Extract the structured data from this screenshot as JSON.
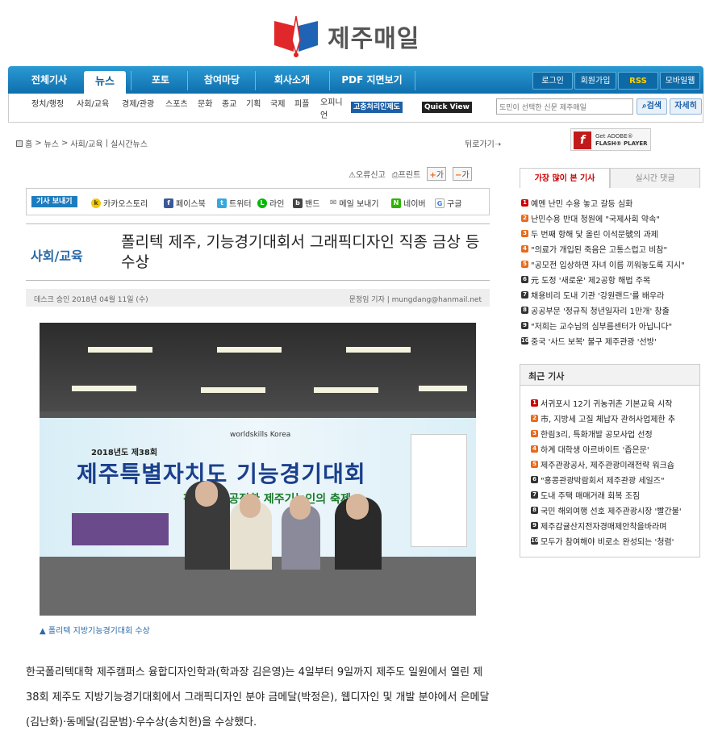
{
  "logo": {
    "text": "제주매일"
  },
  "nav": {
    "items": [
      "전체기사",
      "뉴스",
      "포토",
      "참여마당",
      "회사소개",
      "PDF 지면보기"
    ],
    "right": [
      "로그인",
      "회원가입",
      "RSS",
      "모바일웹"
    ]
  },
  "subnav": {
    "items": [
      "정치/행정",
      "사회/교육",
      "경제/관광",
      "스포츠",
      "문화",
      "종교",
      "기획",
      "국제",
      "피플",
      "오피니언"
    ],
    "btn_grievance": "고충처리인제도",
    "btn_quickview": "Quick View",
    "search_placeholder": "도민이 선택한 신문 제주매일",
    "search_btn": "검색",
    "detail_btn": "자세히"
  },
  "breadcrumb": {
    "home": "홈",
    "sep": ">",
    "l1": "뉴스",
    "l2": "사회/교육",
    "divider": "|",
    "l3": "실시간뉴스"
  },
  "back": "뒤로가기",
  "flash": {
    "line1": "Get ADOBE®",
    "line2": "FLASH® PLAYER"
  },
  "tools": {
    "report": "오류신고",
    "print": "프린트",
    "plus": "가",
    "minus": "가"
  },
  "share": {
    "label": "기사 보내기",
    "items": [
      "카카오스토리",
      "페이스북",
      "트위터",
      "라인",
      "밴드",
      "메일 보내기",
      "네이버",
      "구글"
    ]
  },
  "article": {
    "category": "사회/교육",
    "title": "폴리텍 제주, 기능경기대회서 그래픽디자인 직종 금상 등 수상",
    "meta_left": "데스크 승인 2018년 04월 11일 (수)",
    "meta_right": "문정임 기자 | mungdang@hanmail.net",
    "caption": "▲ 폴리텍 지방기능경기대회 수상",
    "body": "한국폴리텍대학 제주캠퍼스 융합디자인학과(학과장 김은영)는 4일부터 9일까지 제주도 일원에서 열린 제38회 제주도 지방기능경기대회에서 그래픽디자인 분야 금메달(박정은), 웹디자인 및 개발 분야에서 은메달(김난화)·동메달(김문범)·우수상(송치헌)을 수상했다."
  },
  "photo": {
    "banner_small": "2018년도 제38회",
    "banner_big": "제주특별자치도 기능경기대회",
    "banner_slogan": "청렴하고 공정한 제주기능인의 축제",
    "worldskills": "worldskills Korea"
  },
  "popular": {
    "tab_active": "가장 많이 본 기사",
    "tab_other": "실시간 댓글",
    "items": [
      "예멘 난민 수용 놓고 갈등 심화",
      "난민수용 반대 청원에 \"국제사회 약속\"",
      "두 번째 항해 닻 올린 이석문號의 과제",
      "\"의료가 개입된 죽음은 고통스럽고 비참\"",
      "\"공모전 입상하면 자녀 이름 끼워놓도록 지시\"",
      "元 도정 '새로운' 제2공항 해법 주목",
      "채용비리 도내 기관 '강원랜드'를 배우라",
      "공공부문 '정규직 청년일자리 1만개' 창출",
      "\"저희는 교수님의 심부름센터가 아닙니다\"",
      "중국 '사드 보복' 불구 제주관광 '선방'"
    ]
  },
  "recent": {
    "title": "최근 기사",
    "items": [
      "서귀포시 12기 귀농귀촌 기본교육 시작",
      "市, 지방세 고질 체납자 관허사업제한 추",
      "한림3리, 특화개발 공모사업 선정",
      "하계 대학생 아르바이트 '좁은문'",
      "제주관광공사, 제주관광미래전략 워크숍",
      "\"홍콩관광박람회서 제주관광 세일즈\"",
      "도내 주택 매매거래 회복 조짐",
      "국민 해외여행 선호 제주관광시장 '빨간불'",
      "제주감귤산지전자경매제안착을바라며",
      "모두가 참여해야 비로소 완성되는 '청렴'"
    ]
  },
  "colors": {
    "nav_blue": "#1683c4",
    "accent_red": "#cc0000",
    "orange": "#e86a1a",
    "link_blue": "#2a6aa8"
  }
}
